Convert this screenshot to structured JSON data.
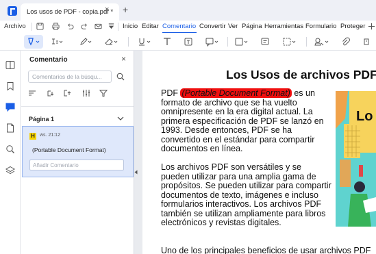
{
  "tab": {
    "title": "Los usos de PDF - copia.pdf *"
  },
  "menu": {
    "file": "Archivo",
    "items": [
      "Inicio",
      "Editar",
      "Comentario",
      "Convertir",
      "Ver",
      "Página",
      "Herramientas",
      "Formulario",
      "Proteger"
    ],
    "active": "Comentario"
  },
  "panel": {
    "title": "Comentario",
    "search_placeholder": "Comentarios de la búsqu...",
    "page_label": "Página 1",
    "comment": {
      "badge": "H",
      "meta": "ws.  21:12",
      "text": "(Portable Document Format)",
      "reply_placeholder": "Añadir Comentario"
    }
  },
  "document": {
    "title": "Los Usos de archivos PDF",
    "p1_before": "PDF ",
    "p1_highlight": "(Portable Document Format)",
    "p1_after": " es un formato de archivo que se ha vuelto omnipresente en la era digital actual. La primera especificación de PDF se lanzó en 1993. Desde entonces, PDF se ha convertido en el estándar para compartir documentos en línea.",
    "p2": "Los archivos PDF son versátiles y se pueden utilizar para una amplia gama de propósitos. Se pueden utilizar para compartir documentos de texto, imágenes e incluso formularios interactivos. Los archivos PDF también se utilizan ampliamente para libros electrónicos y revistas digitales.",
    "p3": "Uno de los principales beneficios de usar archivos PDF",
    "illustration_text": "Lo"
  },
  "colors": {
    "accent": "#1a5ee6",
    "highlight": "#f00f0f",
    "comment_card": "#dfe8fb",
    "illustration": "#5fd3cf"
  },
  "icons": {
    "rail": [
      "panel-icon",
      "bookmark-icon",
      "comment-icon",
      "page-icon",
      "search-icon",
      "layers-icon"
    ],
    "toolbar": [
      "highlight-tool-icon",
      "underline-list-icon",
      "pen-icon",
      "eraser-icon",
      "underline-icon",
      "text-icon",
      "textbox-icon",
      "callout-icon",
      "rectangle-icon",
      "note-icon",
      "area-icon",
      "stamp-icon",
      "attachment-icon"
    ]
  }
}
